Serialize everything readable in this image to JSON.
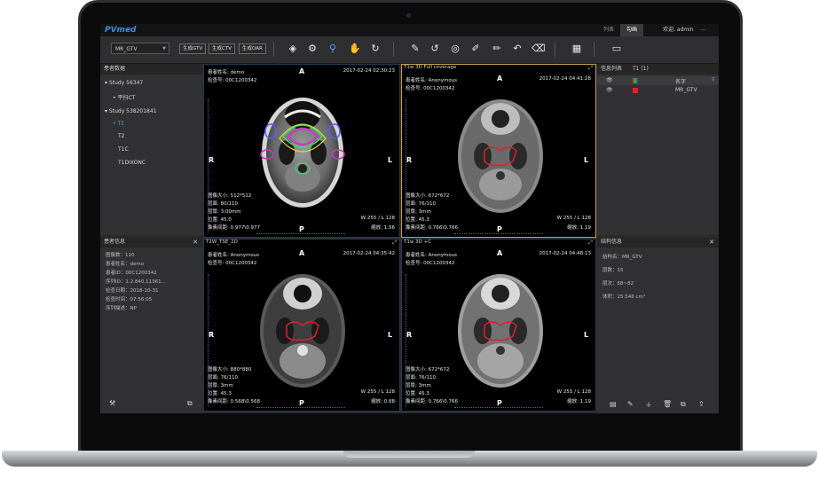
{
  "app": {
    "logo": "PVmed",
    "tabs": [
      {
        "label": "列表"
      },
      {
        "label": "勾画"
      }
    ],
    "user": "欢迎, admin",
    "menu": "···"
  },
  "toolbar": {
    "series_select": "MR_GTV",
    "buttons": [
      {
        "label": "生成GTV"
      },
      {
        "label": "生成CTV"
      },
      {
        "label": "生成OAR"
      }
    ]
  },
  "patient_panel": {
    "title": "患者数据",
    "studies": [
      {
        "label": "Study 56347",
        "series": [
          "平扫CT"
        ]
      },
      {
        "label": "Study 538201841",
        "series": [
          "T1",
          "T2",
          "T1C",
          "T1DIXONC"
        ]
      }
    ]
  },
  "patient_info": {
    "title": "患者信息",
    "lines": [
      "图像数：110",
      "患者姓名：demo",
      "患者ID：00C1200342",
      "序列ID：1.2.840.11361...",
      "检查日期：2018-10-31",
      "检查时间：07:56:05",
      "序列描述：NP"
    ]
  },
  "viewports": [
    {
      "title": "",
      "name": "患者姓名: demo",
      "id": "检查号: 00C1200342",
      "datetime": "2017-02-24 02:30:23",
      "bl": [
        "图像大小: 512*512",
        "层面: 80/110",
        "层厚: 3.00mm",
        "位置: 45.0",
        "像素间距: 0.977\\0.977"
      ],
      "wl": "W 255 / L 128",
      "zoom": "缩放: 1.56",
      "orient": {
        "top": "A",
        "bottom": "P",
        "left": "R",
        "right": "L"
      }
    },
    {
      "title": "T1w 3D Full coverage",
      "name": "患者姓名: Anonymous",
      "id": "检查号: 00C1200342",
      "datetime": "2017-02-24 04:41:28",
      "bl": [
        "图像大小: 672*672",
        "层面: 76/110",
        "层厚: 3mm",
        "位置: 45.3",
        "像素间距: 0.766\\0.766"
      ],
      "wl": "W 255 / L 128",
      "zoom": "缩放: 1.19",
      "orient": {
        "top": "A",
        "bottom": "P",
        "left": "R",
        "right": "L"
      }
    },
    {
      "title": "T2W_TSE_2D",
      "name": "患者姓名: Anonymous",
      "id": "检查号: 00C1200342",
      "datetime": "2017-02-24 04:35:42",
      "bl": [
        "图像大小: 880*880",
        "层面: 76/110",
        "层厚: 3mm",
        "位置: 45.3",
        "像素间距: 0.568\\0.568"
      ],
      "wl": "W 255 / L 128",
      "zoom": "缩放: 0.88",
      "orient": {
        "top": "A",
        "bottom": "P",
        "left": "R",
        "right": "L"
      }
    },
    {
      "title": "T1w 3D +C",
      "name": "患者姓名: Anonymous",
      "id": "检查号: 00C1200342",
      "datetime": "2017-02-24 04:48:13",
      "bl": [
        "图像大小: 672*672",
        "层面: 76/110",
        "层厚: 3mm",
        "位置: 45.3",
        "像素间距: 0.766\\0.766"
      ],
      "wl": "W 255 / L 128",
      "zoom": "缩放: 1.19",
      "orient": {
        "top": "A",
        "bottom": "P",
        "left": "R",
        "right": "L"
      }
    }
  ],
  "info_list": {
    "title": "信息列表",
    "tab": "T1 (1)",
    "col_name": "名字",
    "rows": [
      {
        "name": "MR_GTV",
        "color": "#e0202a"
      }
    ]
  },
  "structure_info": {
    "title": "结构信息",
    "lines": [
      "结构名：MR_GTV",
      "层数：15",
      "层次：68~82",
      "体积：25.546 cm³"
    ]
  },
  "colors": {
    "accent": "#3c8dde",
    "contour": "#e0202a",
    "active_border": "#c8a050"
  }
}
